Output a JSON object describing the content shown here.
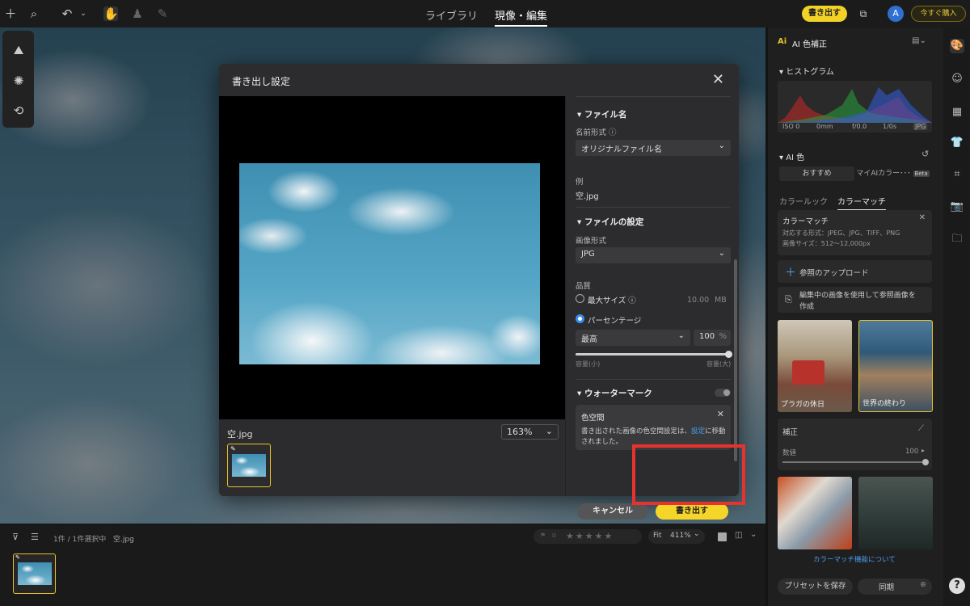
{
  "topbar": {
    "tabs": [
      "ライブラリ",
      "現像・編集"
    ],
    "export_btn": "書き出す",
    "avatar_letter": "A",
    "buy_btn": "今すぐ購入"
  },
  "dialog": {
    "title": "書き出し設定",
    "preview_filename": "空.jpg",
    "zoom": "163%",
    "sections": {
      "filename": "ファイル名",
      "file_settings": "ファイルの設定",
      "watermark": "ウォーターマーク"
    },
    "name_format_label": "名前形式",
    "name_format_value": "オリジナルファイル名",
    "example_label": "例",
    "example_value": "空.jpg",
    "image_format_label": "画像形式",
    "image_format_value": "JPG",
    "quality_label": "品質",
    "max_size_label": "最大サイズ",
    "max_size_value": "10.00",
    "max_size_unit": "MB",
    "percentage_label": "パーセンテージ",
    "quality_preset": "最高",
    "quality_percent": "100",
    "percent_unit": "%",
    "slider_min_label": "容量(小)",
    "slider_max_label": "容量(大)",
    "slider_level": 1.0,
    "toast_title": "色空間",
    "toast_text_before": "書き出された画像の色空間設定は、",
    "toast_link": "設定",
    "toast_text_after": "に移動",
    "toast_text_line2": "されました。",
    "cancel_btn": "キャンセル",
    "export_btn": "書き出す"
  },
  "bottom": {
    "selection_text": "1件 / 1件選択中",
    "filename": "空.jpg",
    "fit_label": "Fit",
    "zoom": "411%",
    "rating_stars": 5
  },
  "rpanel": {
    "header": "AI 色補正",
    "ai_badge": "Ai",
    "histogram_title": "ヒストグラム",
    "hist_meta": [
      "ISO 0",
      "0mm",
      "f/0.0",
      "1/0s",
      "JPG"
    ],
    "ai_color_title": "AI 色",
    "tabs": [
      "おすすめ",
      "マイAIカラー･･･"
    ],
    "beta": "Beta",
    "subtabs": [
      "カラールック",
      "カラーマッチ"
    ],
    "card_title": "カラーマッチ",
    "card_line1": "対応する形式：JPEG、JPG、TIFF、PNG",
    "card_line2": "画像サイズ：512〜12,000px",
    "upload_ref": "参照のアップロード",
    "use_current_line1": "編集中の画像を使用して参照画像を",
    "use_current_line2": "作成",
    "photo_caps": [
      "プラガの休日",
      "世界の終わり"
    ],
    "correction": "補正",
    "amount_label": "数値",
    "amount_value": "100",
    "about_link": "カラーマッチ機能について",
    "save_preset": "プリセットを保存",
    "sync": "同期"
  }
}
